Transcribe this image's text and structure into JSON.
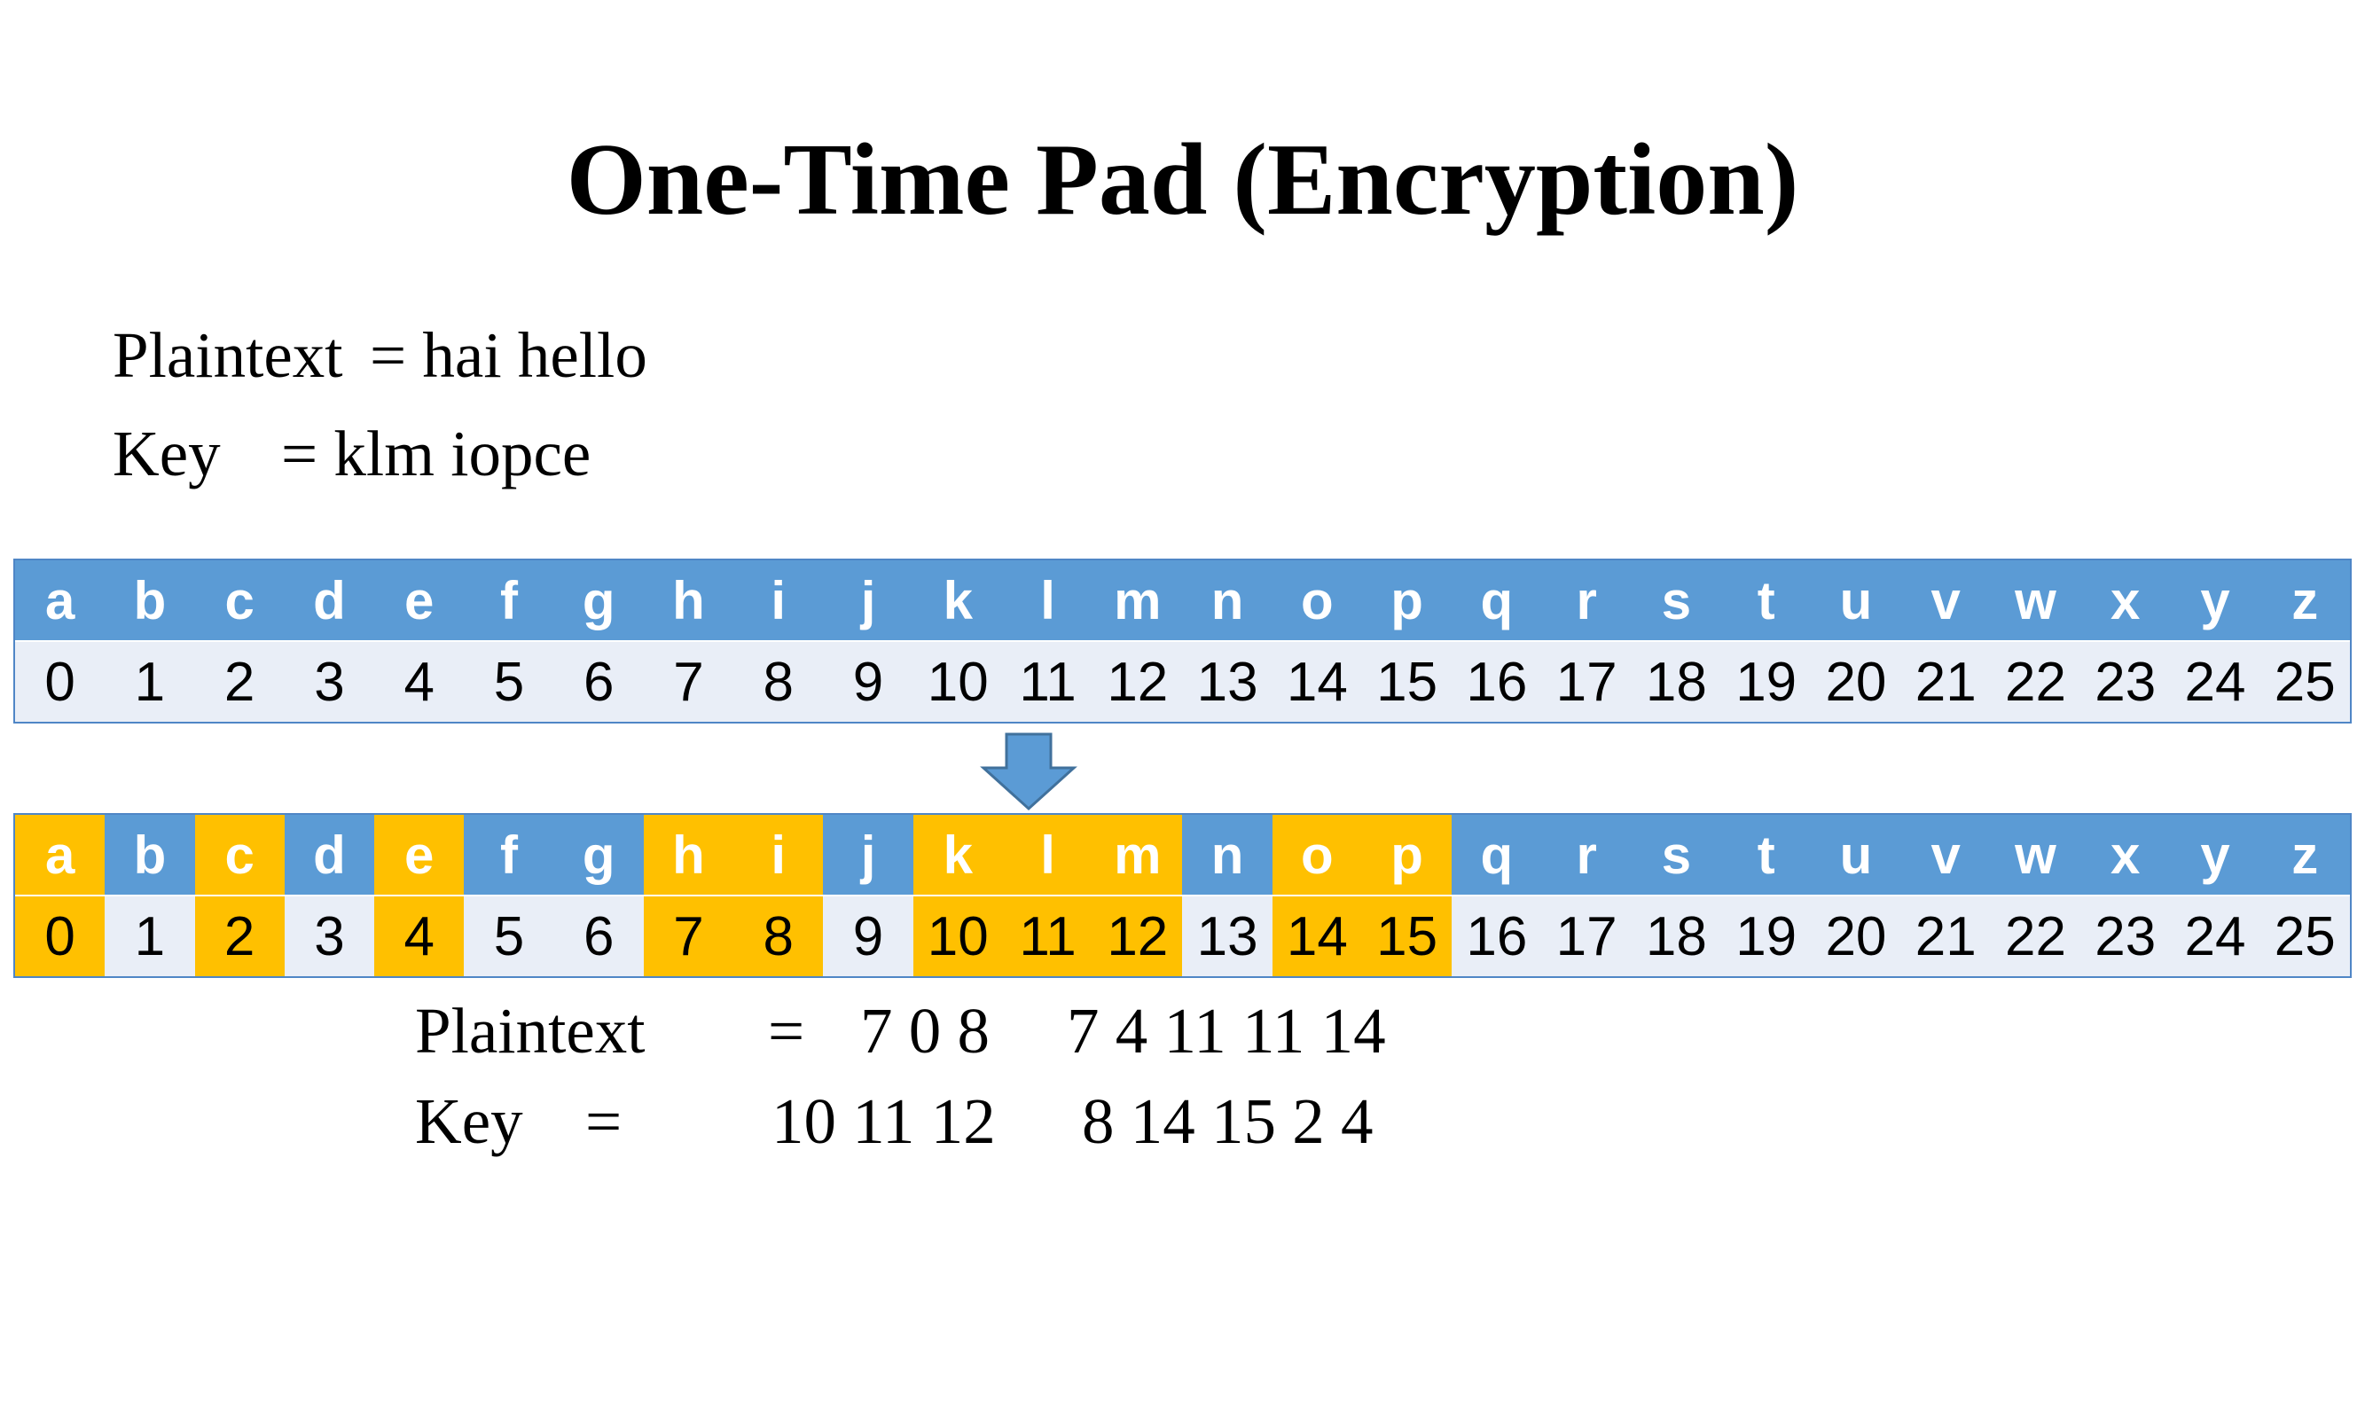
{
  "title": "One-Time Pad (Encryption)",
  "intro": {
    "plaintext_label": "Plaintext",
    "plaintext_eq": "= hai hello",
    "key_label": "Key",
    "key_eq": "= klm iopce"
  },
  "alphabet": [
    "a",
    "b",
    "c",
    "d",
    "e",
    "f",
    "g",
    "h",
    "i",
    "j",
    "k",
    "l",
    "m",
    "n",
    "o",
    "p",
    "q",
    "r",
    "s",
    "t",
    "u",
    "v",
    "w",
    "x",
    "y",
    "z"
  ],
  "numbers": [
    "0",
    "1",
    "2",
    "3",
    "4",
    "5",
    "6",
    "7",
    "8",
    "9",
    "10",
    "11",
    "12",
    "13",
    "14",
    "15",
    "16",
    "17",
    "18",
    "19",
    "20",
    "21",
    "22",
    "23",
    "24",
    "25"
  ],
  "highlighted_indices": [
    0,
    2,
    4,
    7,
    8,
    10,
    11,
    12,
    14,
    15
  ],
  "colors": {
    "header_blue": "#5b9bd5",
    "number_row_light": "#e9eef7",
    "highlight_yellow": "#ffc000",
    "arrow_blue": "#5b9bd5"
  },
  "arrow_icon": "down-arrow-icon",
  "calc": {
    "plaintext_label": "Plaintext",
    "plaintext_eq": "=",
    "plaintext_word1": "7 0 8",
    "plaintext_word2": "7 4 11 11 14",
    "key_label": "Key",
    "key_eq": "=",
    "key_word1": "10 11 12",
    "key_word2": "8 14 15 2 4"
  }
}
